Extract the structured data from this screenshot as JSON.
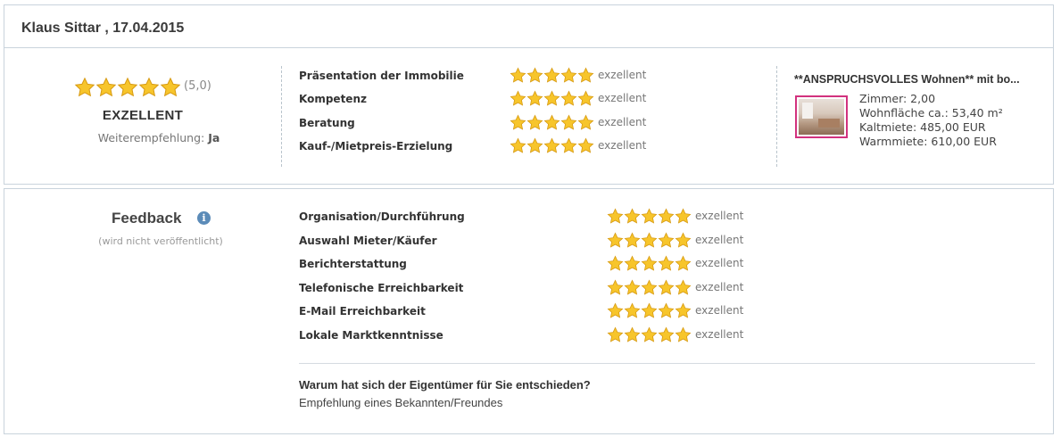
{
  "review": {
    "header": "Klaus Sittar , 17.04.2015",
    "overall": {
      "stars": 5,
      "score": "(5,0)",
      "label": "EXZELLENT",
      "recommend_label": "Weiterempfehlung:",
      "recommend_value": "Ja"
    },
    "criteria": [
      {
        "label": "Präsentation der Immobilie",
        "stars": 5,
        "rating": "exzellent"
      },
      {
        "label": "Kompetenz",
        "stars": 5,
        "rating": "exzellent"
      },
      {
        "label": "Beratung",
        "stars": 5,
        "rating": "exzellent"
      },
      {
        "label": "Kauf-/Mietpreis-Erzielung",
        "stars": 5,
        "rating": "exzellent"
      }
    ],
    "property": {
      "title": "**ANSPRUCHSVOLLES Wohnen** mit bo...",
      "lines": [
        "Zimmer: 2,00",
        "Wohnfläche ca.: 53,40 m²",
        "Kaltmiete: 485,00 EUR",
        "Warmmiete: 610,00 EUR"
      ]
    }
  },
  "feedback": {
    "title": "Feedback",
    "info_icon": "info-icon",
    "subtitle": "(wird nicht veröffentlicht)",
    "criteria": [
      {
        "label": "Organisation/Durchführung",
        "stars": 5,
        "rating": "exzellent"
      },
      {
        "label": "Auswahl Mieter/Käufer",
        "stars": 5,
        "rating": "exzellent"
      },
      {
        "label": "Berichterstattung",
        "stars": 5,
        "rating": "exzellent"
      },
      {
        "label": "Telefonische Erreichbarkeit",
        "stars": 5,
        "rating": "exzellent"
      },
      {
        "label": "E-Mail Erreichbarkeit",
        "stars": 5,
        "rating": "exzellent"
      },
      {
        "label": "Lokale Marktkenntnisse",
        "stars": 5,
        "rating": "exzellent"
      }
    ],
    "question": "Warum hat sich der Eigentümer für Sie entschieden?",
    "answer": "Empfehlung eines Bekannten/Freundes"
  },
  "colors": {
    "star_fill": "#f7c52b",
    "star_stroke": "#d79a12",
    "thumb_border": "#d2327e",
    "info": "#5b8bb8"
  }
}
